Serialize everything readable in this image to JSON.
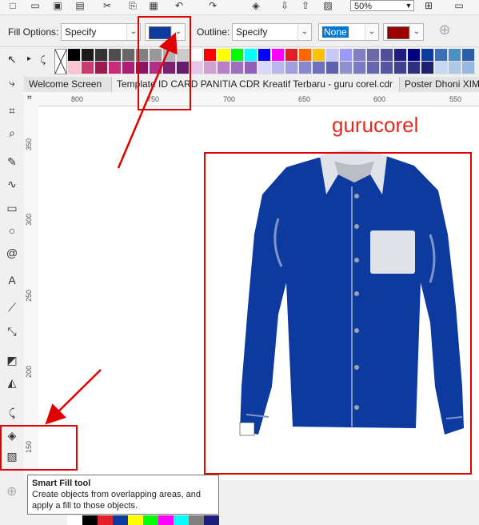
{
  "toolbar": {
    "zoom_value": "50%"
  },
  "property_bar": {
    "fill_label": "Fill Options:",
    "fill_value": "Specify",
    "fill_color": "#0d3a9e",
    "outline_label": "Outline:",
    "outline_value": "Specify",
    "outline_width": "None",
    "outline_color": "#9a0000"
  },
  "palette": {
    "row1": [
      "#000000",
      "#1a1a1a",
      "#333333",
      "#4d4d4d",
      "#666666",
      "#808080",
      "#999999",
      "#b3b3b3",
      "#cccccc",
      "#ffffff",
      "#ff0000",
      "#ffff00",
      "#00ff00",
      "#00ffff",
      "#0000ff",
      "#ff00ff",
      "#e11f26",
      "#ff6600",
      "#ffc200",
      "#c8c8ff",
      "#9999ff",
      "#8080c0",
      "#6a6aa8",
      "#4f4f9c",
      "#1e1e80",
      "#000080",
      "#0d3a9e",
      "#3d6fb6",
      "#4a90c2",
      "#2d5fa8"
    ],
    "row2": [
      "#fbc5d0",
      "#c73c6d",
      "#9b1b50",
      "#c62d76",
      "#ae1c74",
      "#8a1560",
      "#b02f8a",
      "#7b2170",
      "#671b6e",
      "#e6c6e6",
      "#d0a0d0",
      "#b880c8",
      "#a070c0",
      "#9060b8",
      "#d8d8ff",
      "#b8b8ee",
      "#a0a0e0",
      "#8888d0",
      "#7070c0",
      "#6060b0",
      "#9090d0",
      "#7a7ac0",
      "#6767b0",
      "#5555a0",
      "#404090",
      "#303080",
      "#202070",
      "#c8d8f0",
      "#b0c8e8",
      "#98b8e0"
    ]
  },
  "tabs": [
    "Welcome Screen",
    "Template ID CARD PANITIA CDR Kreatif Terbaru - guru corel.cdr",
    "Poster Dhoni XIM"
  ],
  "ruler": {
    "h_ticks": [
      "800",
      "750",
      "700",
      "650",
      "600",
      "550"
    ],
    "v_ticks": [
      "350",
      "300",
      "250",
      "200",
      "150"
    ]
  },
  "canvas": {
    "watermark": "gurucorel",
    "shirt_color": "#0d3a9e",
    "collar_color": "#dfe3e8"
  },
  "tooltip": {
    "title": "Smart Fill tool",
    "body": "Create objects from overlapping areas, and apply a fill to those objects."
  }
}
